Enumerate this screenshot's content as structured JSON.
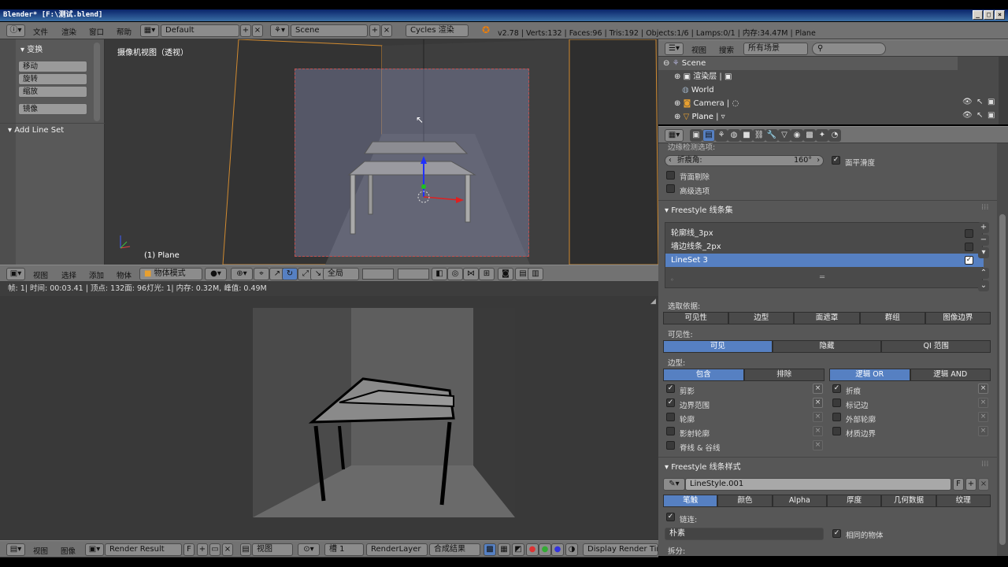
{
  "window": {
    "title": "Blender* [F:\\测试.blend]"
  },
  "top_header": {
    "menus": [
      "文件",
      "渲染",
      "窗口",
      "帮助"
    ],
    "screen_layout": "Default",
    "scene": "Scene",
    "render_engine": "Cycles 渲染",
    "stats": "v2.78 | Verts:132 | Faces:96 | Tris:192 | Objects:1/6 | Lamps:0/1 | 内存:34.47M | Plane"
  },
  "tool_shelf": {
    "transform_title": "变换",
    "buttons": [
      "移动",
      "旋转",
      "缩放",
      "镜像"
    ],
    "add_line_set": "Add Line Set"
  },
  "viewport": {
    "view_label": "摄像机视图（透视）",
    "object_label": "(1) Plane"
  },
  "view3d_header": {
    "menus": [
      "视图",
      "选择",
      "添加",
      "物体"
    ],
    "mode": "物体模式",
    "orientation": "全局"
  },
  "info_bar": {
    "text": "帧: 1| 时间: 00:03.41 | 顶点: 132面: 96灯光: 1| 内存: 0.32M, 峰值: 0.49M"
  },
  "image_header": {
    "menus": [
      "视图",
      "图像"
    ],
    "image": "Render Result",
    "f_label": "F",
    "view": "视图",
    "slot": "槽 1",
    "layer": "RenderLayer",
    "pass": "合成结果",
    "display_button": "Display Render Tim"
  },
  "outliner": {
    "menus": [
      "视图",
      "搜索"
    ],
    "filter": "所有场景",
    "rows": [
      {
        "label": "Scene"
      },
      {
        "label": "渲染层"
      },
      {
        "label": "World"
      },
      {
        "label": "Camera"
      },
      {
        "label": "Plane"
      }
    ]
  },
  "properties": {
    "edge_detect_cut": "边缘检测选项:",
    "crease_angle_label": "折痕角:",
    "crease_angle_value": "160°",
    "face_smooth": "面平滑度",
    "backface_cull": "背面剔除",
    "advanced": "高级选项",
    "lineset_section": "Freestyle 线条集",
    "linesets": [
      "轮廓线_3px",
      "墙边线条_2px",
      "LineSet 3"
    ],
    "select_by_label": "选取依据:",
    "select_by_tabs": [
      "可见性",
      "边型",
      "面遮罩",
      "群组",
      "图像边界"
    ],
    "visibility_label": "可见性:",
    "visibility_tabs": [
      "可见",
      "隐藏",
      "QI 范围"
    ],
    "edge_type_label": "边型:",
    "include_tabs": [
      "包含",
      "排除"
    ],
    "logic_tabs": [
      "逻辑 OR",
      "逻辑 AND"
    ],
    "edge_left": [
      "剪影",
      "边界范围",
      "轮廓",
      "影射轮廓",
      "脊线 & 谷线"
    ],
    "edge_right": [
      "折痕",
      "标记边",
      "外部轮廓",
      "材质边界"
    ],
    "linestyle_section": "Freestyle 线条样式",
    "linestyle_name": "LineStyle.001",
    "linestyle_f": "F",
    "linestyle_tabs": [
      "笔触",
      "颜色",
      "Alpha",
      "厚度",
      "几何数据",
      "纹理"
    ],
    "chaining": "链连:",
    "chain_type": "朴素",
    "same_object": "相同的物体",
    "split": "拆分:"
  },
  "colors": {
    "accent": "#5680c2",
    "panel": "#575757",
    "header": "#727272"
  }
}
